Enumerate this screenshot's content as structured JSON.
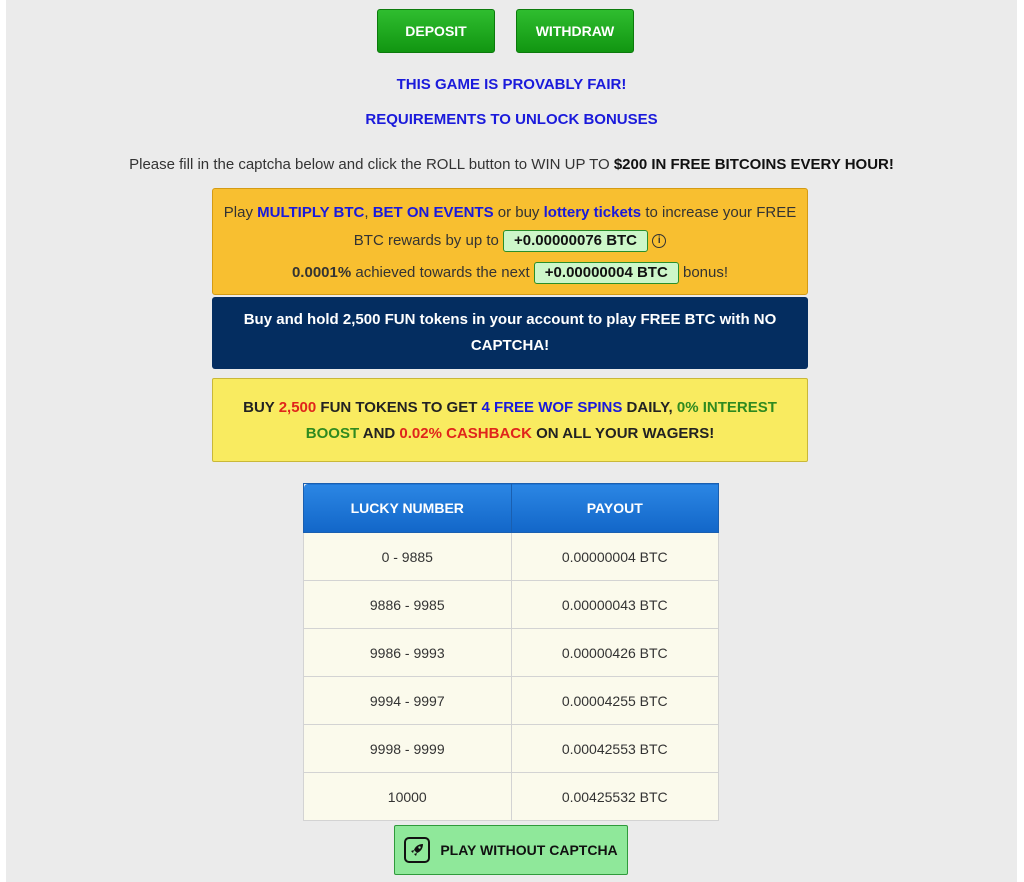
{
  "actions": {
    "deposit_label": "DEPOSIT",
    "withdraw_label": "WITHDRAW"
  },
  "links": {
    "provably_fair": "THIS GAME IS PROVABLY FAIR!",
    "requirements": "REQUIREMENTS TO UNLOCK BONUSES"
  },
  "intro": {
    "text": "Please fill in the captcha below and click the ROLL button to WIN UP TO ",
    "bold": "$200 IN FREE BITCOINS EVERY HOUR!"
  },
  "rewards_box": {
    "play": "Play ",
    "multiply": "MULTIPLY BTC",
    "comma": ", ",
    "bet": "BET ON EVENTS",
    "or_buy": " or buy ",
    "lottery": "lottery tickets",
    "increase": " to increase your FREE BTC rewards by up to ",
    "reward_value": "+0.00000076 BTC",
    "info_icon": "i",
    "progress_percent": "0.0001%",
    "achieved": " achieved towards the next ",
    "next_bonus_value": "+0.00000004 BTC",
    "bonus": " bonus!"
  },
  "fun_banner": {
    "text": "Buy and hold 2,500 FUN tokens in your account to play FREE BTC with NO CAPTCHA!"
  },
  "promo_box": {
    "buy": "BUY ",
    "amount": "2,500",
    "fun_tokens": " FUN TOKENS TO GET ",
    "spins": "4 FREE WOF SPINS",
    "daily": " DAILY, ",
    "interest": "0% INTEREST BOOST",
    "and": " AND ",
    "cashback": "0.02% CASHBACK",
    "wagers": " ON ALL YOUR WAGERS!"
  },
  "payout_table": {
    "headers": [
      "LUCKY NUMBER",
      "PAYOUT"
    ],
    "rows": [
      [
        "0 - 9885",
        "0.00000004 BTC"
      ],
      [
        "9886 - 9985",
        "0.00000043 BTC"
      ],
      [
        "9986 - 9993",
        "0.00000426 BTC"
      ],
      [
        "9994 - 9997",
        "0.00004255 BTC"
      ],
      [
        "9998 - 9999",
        "0.00042553 BTC"
      ],
      [
        "10000",
        "0.00425532 BTC"
      ]
    ]
  },
  "play_button": {
    "label": "PLAY WITHOUT CAPTCHA",
    "icon": "rocket-icon"
  }
}
